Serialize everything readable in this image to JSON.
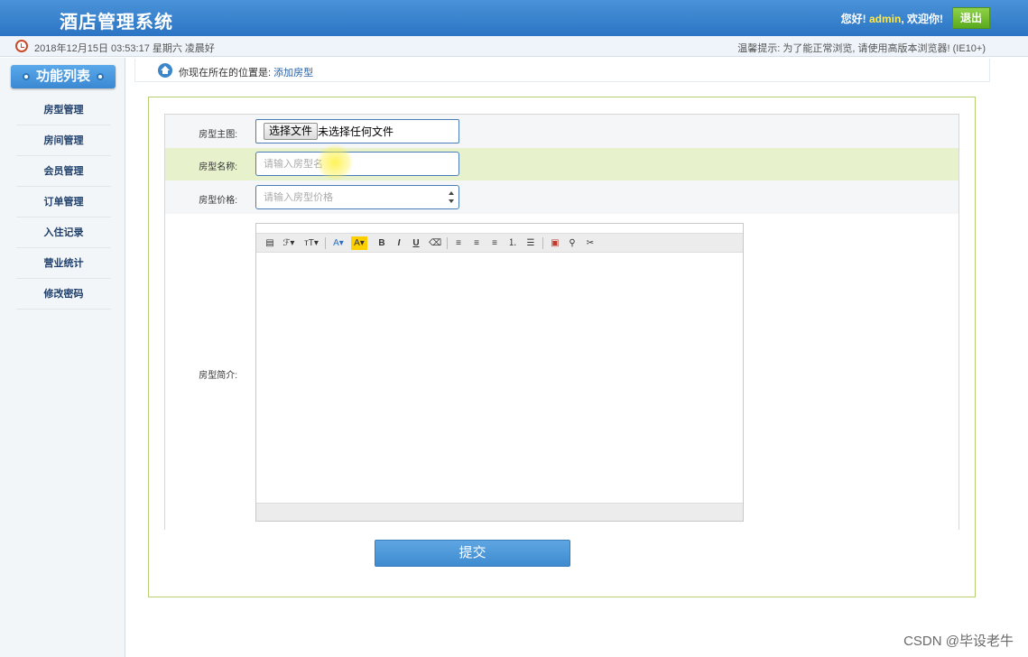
{
  "header": {
    "title": "酒店管理系统",
    "greeting_prefix": "您好! ",
    "username": "admin",
    "greeting_suffix": ", 欢迎你!",
    "logout_label": "退出"
  },
  "infobar": {
    "datetime": "2018年12月15日 03:53:17 星期六  凌晨好",
    "hint": "温馨提示: 为了能正常浏览, 请使用高版本浏览器! (IE10+)"
  },
  "sidebar": {
    "title": "功能列表",
    "items": [
      {
        "label": "房型管理"
      },
      {
        "label": "房间管理"
      },
      {
        "label": "会员管理"
      },
      {
        "label": "订单管理"
      },
      {
        "label": "入住记录"
      },
      {
        "label": "营业统计"
      },
      {
        "label": "修改密码"
      }
    ]
  },
  "breadcrumb": {
    "prefix": "你现在所在的位置是: ",
    "current": "添加房型"
  },
  "form": {
    "image": {
      "label": "房型主图:",
      "button_label": "选择文件",
      "status": "未选择任何文件"
    },
    "name": {
      "label": "房型名称:",
      "placeholder": "请输入房型名",
      "value": ""
    },
    "price": {
      "label": "房型价格:",
      "placeholder": "请输入房型价格",
      "value": ""
    },
    "intro": {
      "label": "房型简介:",
      "toolbar": [
        {
          "name": "source-icon",
          "glyph": "▤"
        },
        {
          "name": "font-family-icon",
          "glyph": "ℱ▾"
        },
        {
          "name": "font-size-icon",
          "glyph": "тT▾"
        },
        {
          "name": "font-color-icon",
          "glyph": "A▾"
        },
        {
          "name": "highlight-color-icon",
          "glyph": "A▾"
        },
        {
          "name": "bold-icon",
          "glyph": "B"
        },
        {
          "name": "italic-icon",
          "glyph": "I"
        },
        {
          "name": "underline-icon",
          "glyph": "U"
        },
        {
          "name": "eraser-icon",
          "glyph": "⌫"
        },
        {
          "name": "align-left-icon",
          "glyph": "≡"
        },
        {
          "name": "align-center-icon",
          "glyph": "≡"
        },
        {
          "name": "align-right-icon",
          "glyph": "≡"
        },
        {
          "name": "ordered-list-icon",
          "glyph": "⒈"
        },
        {
          "name": "unordered-list-icon",
          "glyph": "☰"
        },
        {
          "name": "image-icon",
          "glyph": "▣"
        },
        {
          "name": "link-icon",
          "glyph": "⚲"
        },
        {
          "name": "unlink-icon",
          "glyph": "✂"
        }
      ]
    },
    "submit_label": "提交"
  },
  "watermark": "CSDN @毕设老牛",
  "colors": {
    "header_blue": "#2b74c4",
    "accent_green": "#5aaa1e",
    "highlight_row": "#e7f1cc",
    "link_blue": "#2661a7"
  }
}
